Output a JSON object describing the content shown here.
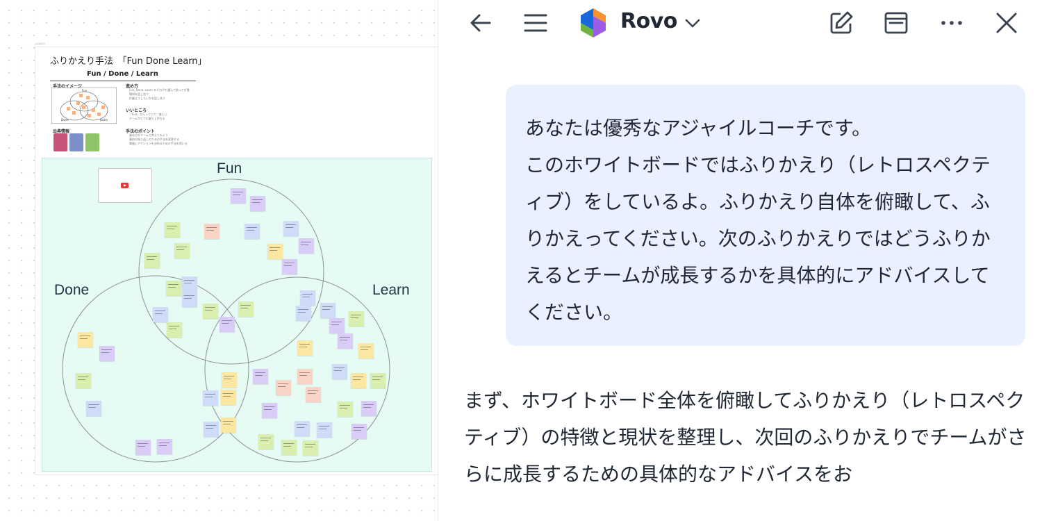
{
  "whiteboard": {
    "frame_label": "ふりかえり",
    "guide": {
      "title": "ふりかえり手法　「Fun Done Learn」",
      "subtitle": "Fun / Done / Learn",
      "image_heading": "手法のイメージ",
      "steps_heading": "進め方",
      "steps": [
        "Fun, Done, Learn をそれぞれ選んで貼って付箋",
        "場所を話し合う",
        "作業どうしたいかを話し合う"
      ],
      "good_heading": "いいところ",
      "good": [
        "「Fun」が入っていて、楽しい",
        "チームがとても盛り上がれる"
      ],
      "source_heading": "出典情報",
      "points_heading": "手法のポイント",
      "points": [
        "進め方をチームで考えてみよう",
        "事前の振り返しのための手法を変更する",
        "事後にアクションを決めるための手法を用いる"
      ],
      "mini_labels": {
        "fun": "Fun",
        "done": "Done",
        "learn": "Learn"
      }
    },
    "venn": {
      "labels": {
        "fun": "Fun",
        "done": "Done",
        "learn": "Learn"
      }
    },
    "sticky_colors": {
      "purple": "#d9ccf7",
      "blue": "#cfdcf9",
      "green": "#d9efb0",
      "yellow": "#fbe7a1",
      "pink": "#f9d3c6"
    }
  },
  "panel": {
    "toolbar": {
      "back_icon": "arrow-left-icon",
      "menu_icon": "hamburger-icon",
      "app_name": "Rovo",
      "compose_icon": "edit-icon",
      "layout_icon": "panel-icon",
      "more_icon": "ellipsis-icon",
      "close_icon": "close-icon"
    },
    "user_message": "あなたは優秀なアジャイルコーチです。\nこのホワイトボードではふりかえり（レトロスペクティブ）をしているよ。ふりかえり自体を俯瞰して、ふりかえってください。次のふりかえりではどうふりかえるとチームが成長するかを具体的にアドバイスしてください。",
    "assistant_message": "まず、ホワイトボード全体を俯瞰してふりかえり（レトロスペクティブ）の特徴と現状を整理し、次回のふりかえりでチームがさらに成長するための具体的なアドバイスをお"
  },
  "colors": {
    "venn_background": "#e6fbf3",
    "bubble": "#e9f1fe",
    "text": "#1f2733",
    "rovo_blue": "#1868db",
    "rovo_purple": "#9b5de5",
    "rovo_orange": "#f79233",
    "rovo_green": "#6fb440"
  }
}
